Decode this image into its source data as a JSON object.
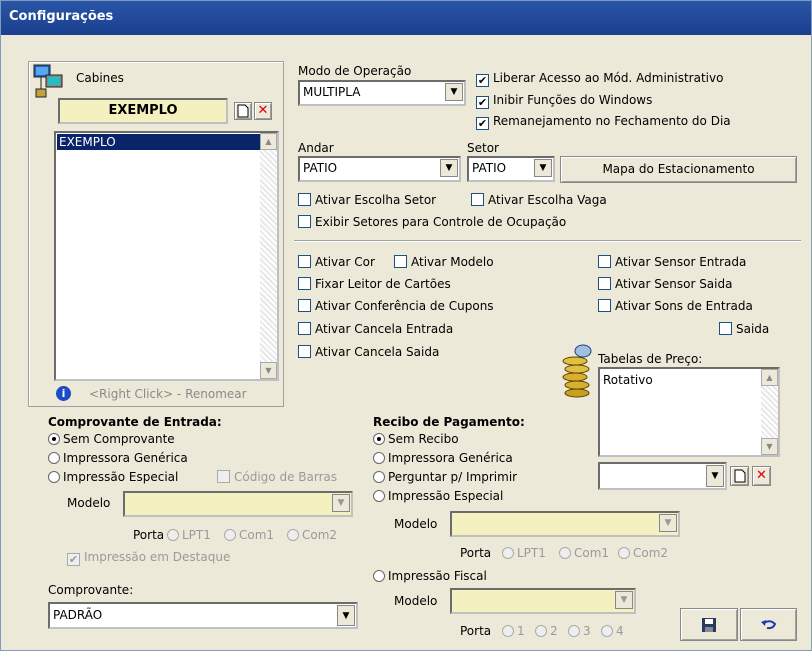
{
  "window": {
    "title": "Configurações"
  },
  "cabines": {
    "label": "Cabines",
    "selected": "EXEMPLO",
    "items": [
      "EXEMPLO"
    ],
    "hint": "<Right Click> - Renomear"
  },
  "modo": {
    "label": "Modo de Operação",
    "value": "MULTIPLA"
  },
  "options_top": {
    "liberar": "Liberar Acesso ao Mód. Administrativo",
    "inibir": "Inibir Funções do Windows",
    "remanejamento": "Remanejamento no Fechamento do Dia"
  },
  "andar": {
    "label": "Andar",
    "value": "PATIO"
  },
  "setor": {
    "label": "Setor",
    "value": "PATIO"
  },
  "mapa_button": "Mapa do Estacionamento",
  "checks_mid": {
    "escolha_setor": "Ativar Escolha Setor",
    "escolha_vaga": "Ativar Escolha Vaga",
    "exibir_setores": "Exibir Setores para Controle de Ocupação"
  },
  "checks_low": {
    "cor": "Ativar Cor",
    "modelo": "Ativar Modelo",
    "leitor": "Fixar Leitor de Cartões",
    "cupons": "Ativar Conferência de Cupons",
    "cancela_entrada": "Ativar Cancela Entrada",
    "cancela_saida": "Ativar Cancela Saida",
    "sensor_entrada": "Ativar Sensor Entrada",
    "sensor_saida": "Ativar Sensor Saida",
    "sons_entrada": "Ativar Sons de Entrada",
    "saida": "Saida"
  },
  "tabelas": {
    "label": "Tabelas de Preço:",
    "items": [
      "Rotativo"
    ]
  },
  "comprovante_entrada": {
    "title": "Comprovante de Entrada:",
    "sem": "Sem Comprovante",
    "generica": "Impressora Genérica",
    "especial": "Impressão Especial",
    "codigo_barras": "Código de Barras",
    "modelo_label": "Modelo",
    "porta_label": "Porta",
    "lpt1": "LPT1",
    "com1": "Com1",
    "com2": "Com2",
    "destaque": "Impressão em Destaque"
  },
  "comprovante": {
    "label": "Comprovante:",
    "value": "PADRÃO"
  },
  "recibo": {
    "title": "Recibo de Pagamento:",
    "sem": "Sem Recibo",
    "generica": "Impressora Genérica",
    "perguntar": "Perguntar p/ Imprimir",
    "especial": "Impressão Especial",
    "modelo_label": "Modelo",
    "porta_label": "Porta",
    "lpt1": "LPT1",
    "com1": "Com1",
    "com2": "Com2",
    "fiscal": "Impressão Fiscal",
    "modelo2_label": "Modelo",
    "porta2_label": "Porta",
    "p1": "1",
    "p2": "2",
    "p3": "3",
    "p4": "4"
  },
  "icons": {
    "new": "new-document-icon",
    "delete": "delete-x-icon",
    "info": "info-icon",
    "save": "floppy-disk-icon",
    "undo": "undo-arrow-icon"
  }
}
